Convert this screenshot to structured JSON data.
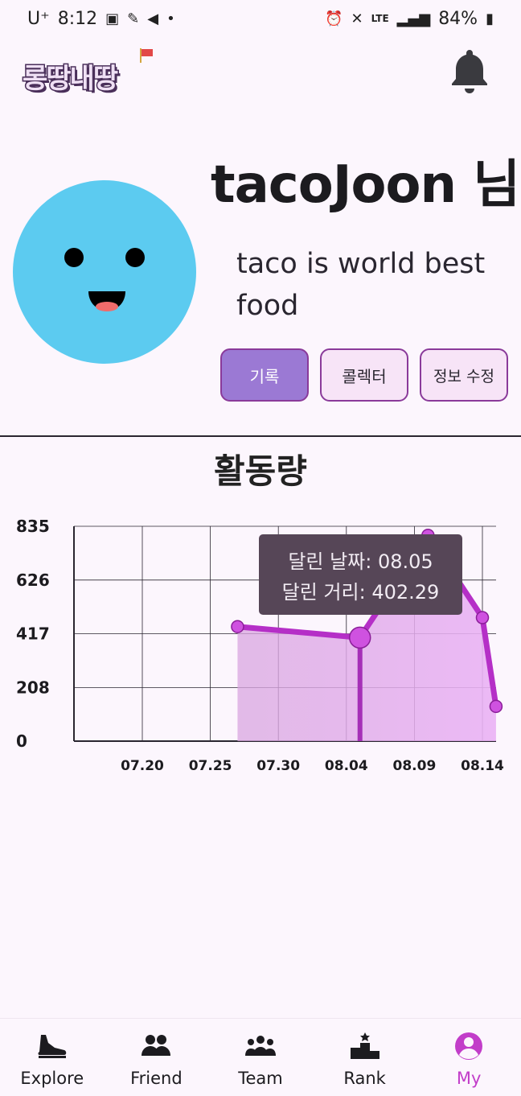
{
  "status_bar": {
    "carrier": "U⁺",
    "time": "8:12",
    "network": "LTE",
    "battery": "84%"
  },
  "header": {
    "logo_text": "롱땅내땅",
    "bell_icon": "bell-icon"
  },
  "profile": {
    "username": "tacoJoon 님",
    "bio": "taco is world best food",
    "avatar_icon": "smiley-face",
    "buttons": [
      {
        "label": "기록",
        "active": true
      },
      {
        "label": "콜렉터",
        "active": false
      },
      {
        "label": "정보 수정",
        "active": false
      }
    ]
  },
  "chart_title": "활동량",
  "chart_data": {
    "type": "area",
    "x_ticks": [
      "07.20",
      "07.25",
      "07.30",
      "08.04",
      "08.09",
      "08.14"
    ],
    "y_ticks": [
      0,
      208,
      417,
      626,
      835
    ],
    "ylim": [
      0,
      835
    ],
    "points": [
      {
        "date": "07.27",
        "value": 445
      },
      {
        "date": "08.05",
        "value": 402.29
      },
      {
        "date": "08.10",
        "value": 800
      },
      {
        "date": "08.14",
        "value": 480
      },
      {
        "date": "08.15",
        "value": 135
      }
    ],
    "tooltip": {
      "date_label": "달린 날짜: 08.05",
      "distance_label": "달린 거리: 402.29"
    },
    "colors": {
      "line": "#b52fc7",
      "fill": "#e3a8ee",
      "tooltip_bg": "#564657"
    }
  },
  "bottom_nav": [
    {
      "label": "Explore",
      "icon": "shoe-icon",
      "active": false
    },
    {
      "label": "Friend",
      "icon": "friends-icon",
      "active": false
    },
    {
      "label": "Team",
      "icon": "team-icon",
      "active": false
    },
    {
      "label": "Rank",
      "icon": "podium-icon",
      "active": false
    },
    {
      "label": "My",
      "icon": "account-circle-icon",
      "active": true
    }
  ]
}
